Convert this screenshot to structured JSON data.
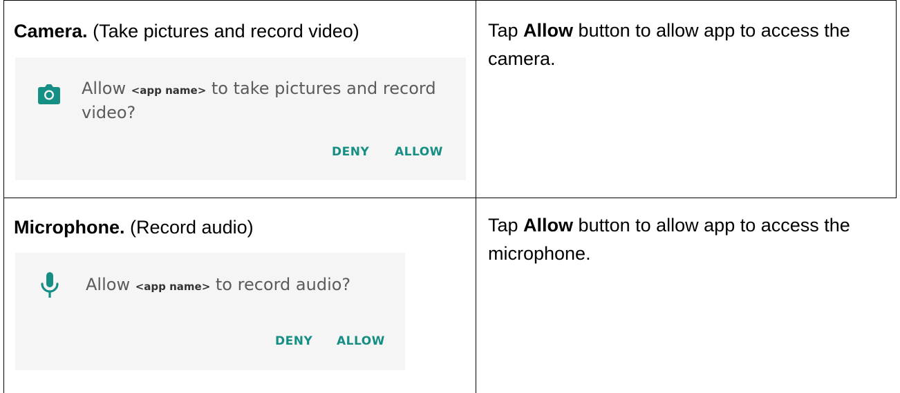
{
  "rows": [
    {
      "heading_bold": "Camera.",
      "heading_rest": " (Take pictures and record video)",
      "dialog": {
        "icon": "camera-icon",
        "text_before": "Allow ",
        "app_token": "<app name>",
        "text_after": " to take pictures and record video?",
        "deny_label": "DENY",
        "allow_label": "ALLOW"
      },
      "desc_prefix": "Tap ",
      "desc_bold": "Allow",
      "desc_suffix": " button to allow app to access the camera."
    },
    {
      "heading_bold": "Microphone.",
      "heading_rest": " (Record audio)",
      "dialog": {
        "icon": "microphone-icon",
        "text_before": "Allow ",
        "app_token": "<app name>",
        "text_after": " to record audio?",
        "deny_label": "DENY",
        "allow_label": "ALLOW"
      },
      "desc_prefix": "Tap ",
      "desc_bold": "Allow",
      "desc_suffix": " button to allow app to access the microphone."
    }
  ],
  "colors": {
    "accent": "#158f83",
    "dialog_bg": "#f5f5f5",
    "dialog_text": "#5b5b5b"
  }
}
